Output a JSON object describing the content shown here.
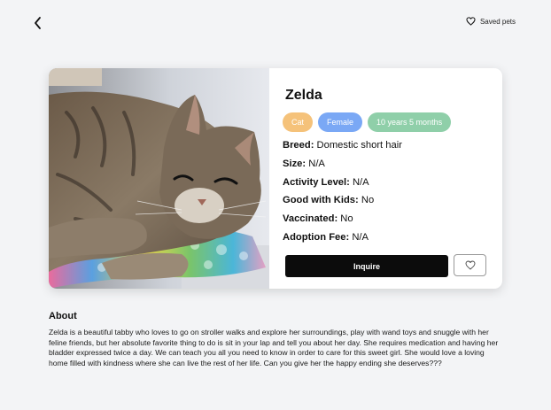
{
  "header": {
    "back_icon": "chevron-left-icon",
    "saved_label": "Saved pets",
    "saved_icon": "heart-outline-icon"
  },
  "pet": {
    "name": "Zelda",
    "photo": "tabby-cat-photo",
    "tags": {
      "species": "Cat",
      "sex": "Female",
      "age": "10 years 5 months"
    },
    "tag_colors": {
      "species": "#f5c27a",
      "sex": "#7aa8f5",
      "age": "#8fcfa9"
    },
    "facts": {
      "breed_label": "Breed:",
      "breed": "Domestic short hair",
      "size_label": "Size:",
      "size": "N/A",
      "activity_label": "Activity Level:",
      "activity": "N/A",
      "kids_label": "Good with Kids:",
      "kids": "No",
      "vaccinated_label": "Vaccinated:",
      "vaccinated": "No",
      "fee_label": "Adoption Fee:",
      "fee": "N/A"
    },
    "actions": {
      "inquire_label": "Inquire",
      "favorite_icon": "heart-outline-icon"
    }
  },
  "about": {
    "title": "About",
    "text": "Zelda is a beautiful tabby who loves to go on stroller walks and explore her surroundings, play with wand toys and snuggle with her feline friends, but her absolute favorite thing to do is sit in your lap and tell you about her day. She requires medication and having her bladder expressed twice a day. We can teach you all you need to know in order to care for this sweet girl. She would love a loving home filled with kindness where she can live the rest of her life. Can you give her the happy ending she deserves???"
  }
}
